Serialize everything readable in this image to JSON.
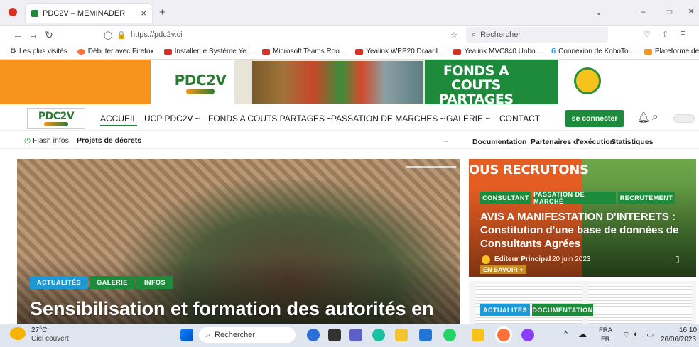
{
  "browser": {
    "tab_title": "PDC2V – MEMINADER",
    "close_label": "×",
    "new_tab_label": "+",
    "url": "https://pdc2v.ci",
    "search_placeholder": "Rechercher",
    "window_controls": [
      "⌄",
      "–",
      "▭",
      "✕"
    ]
  },
  "bookmarks": [
    {
      "label": "Les plus visités",
      "color": "#555555"
    },
    {
      "label": "Débuter avec Firefox",
      "color": "#ff7139"
    },
    {
      "label": "Installer le Systéme Ye...",
      "color": "#d93025"
    },
    {
      "label": "Microsoft Teams Roo...",
      "color": "#d93025"
    },
    {
      "label": "Yealink WPP20 Draadl...",
      "color": "#d93025"
    },
    {
      "label": "Yealink MVC840 Unbo...",
      "color": "#d93025"
    },
    {
      "label": "Connexion de KoboTo...",
      "color": "#2196f3"
    },
    {
      "label": "Plateforme de Suivi de...",
      "color": "#f7941d"
    }
  ],
  "header": {
    "logo_text": "PDC2V",
    "banner_line1": "FONDS A COUTS",
    "banner_line2": "PARTAGES (FCP)"
  },
  "menu": {
    "items": [
      "ACCUEIL",
      "UCP PDC2V ~",
      "FONDS A COUTS PARTAGES ~",
      "PASSATION DE MARCHES ~",
      "GALERIE ~",
      "CONTACT"
    ],
    "connect_label": "se connecter"
  },
  "flash": {
    "label": "Flash infos",
    "ticker": "Projets de décrets",
    "links": [
      "Documentation",
      "Partenaires d'exécution",
      "Statistiques"
    ]
  },
  "hero": {
    "tags": [
      "ACTUALITÉS",
      "GALERIE",
      "INFOS"
    ],
    "title": "Sensibilisation et formation des autorités en"
  },
  "side_card": {
    "banner": "OUS RECRUTONS",
    "tags": [
      "CONSULTANT",
      "PASSATION DE MARCHÉ",
      "RECRUTEMENT"
    ],
    "title": "AVIS A MANIFESTATION D'INTERETS : Constitution d'une base de données de Consultants Agrées",
    "author": "Editeur Principal",
    "date": "20 juin 2023",
    "read_more": "EN SAVOIR +"
  },
  "side_card2": {
    "tags": [
      "ACTUALITÉS",
      "DOCUMENTATION"
    ]
  },
  "taskbar": {
    "weather_temp": "27°C",
    "weather_desc": "Ciel couvert",
    "search_label": "Rechercher",
    "lang": "FRA",
    "lang2": "FR",
    "time": "16:10",
    "date": "26/06/2023"
  },
  "colors": {
    "green": "#1e8a3c",
    "orange": "#f7941d",
    "tag_blue": "#1d9ad6",
    "tag_green": "#1e8a3c"
  }
}
